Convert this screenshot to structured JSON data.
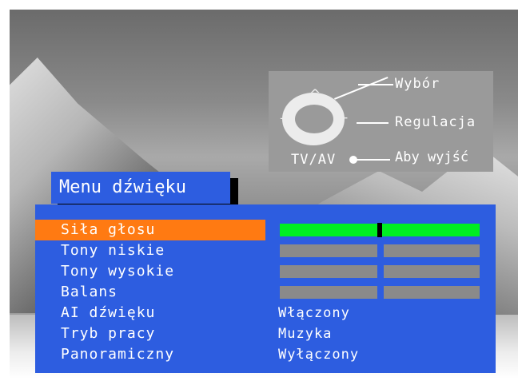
{
  "help": {
    "select_label": "Wybór",
    "adjust_label": "Regulacja",
    "tvav_label": "TV/AV",
    "exit_label": "Aby wyjść",
    "pad_up": "^",
    "pad_down": "v",
    "pad_minus": "—",
    "pad_plus": "+"
  },
  "menu": {
    "title": "Menu dźwięku",
    "items": [
      {
        "label": "Siła głosu",
        "selected": true,
        "control": "slider",
        "level": 0.5
      },
      {
        "label": "Tony niskie",
        "control": "slider",
        "level": 0.5
      },
      {
        "label": "Tony wysokie",
        "control": "slider",
        "level": 0.5
      },
      {
        "label": "Balans",
        "control": "slider",
        "level": 0.5
      },
      {
        "label": "AI dźwięku",
        "value": "Włączony"
      },
      {
        "label": "Tryb pracy",
        "value": "Muzyka"
      },
      {
        "label": "Panoramiczny",
        "value": "Wyłączony"
      }
    ]
  },
  "colors": {
    "panel": "#2d5de0",
    "selected": "#ff7a12",
    "slider_active": "#00ee22",
    "slider_inactive": "#8a8a8a"
  }
}
